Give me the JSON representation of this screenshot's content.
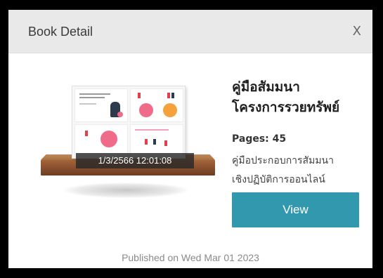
{
  "modal": {
    "title": "Book Detail",
    "close_label": "X"
  },
  "book": {
    "title": "คู่มือสัมมนาโครงการรวยทรัพย์",
    "title_line1": "คู่มือสัมมนา",
    "title_line2": "โครงการรวยทรัพย์",
    "pages_text": "Pages: 45",
    "description_line1": "คู่มือประกอบการสัมมนา",
    "description_line2": "เชิงปฏิบัติการออนไลน์",
    "timestamp": "1/3/2566 12:01:08",
    "published": "Published on Wed Mar 01 2023"
  },
  "actions": {
    "view_label": "View"
  },
  "colors": {
    "accent": "#3298ad",
    "header_bg": "#e9e9e9",
    "shelf": "#8b5230"
  }
}
